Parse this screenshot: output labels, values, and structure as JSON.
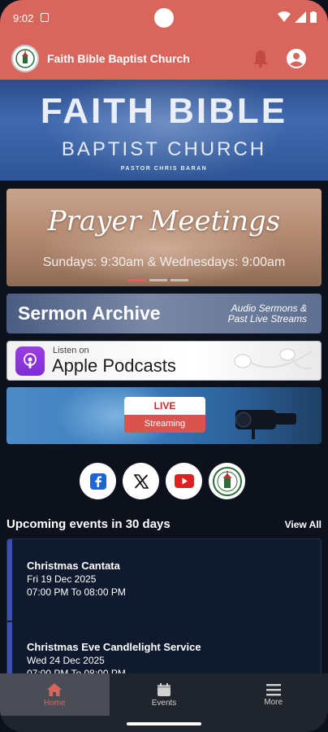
{
  "status_bar": {
    "time": "9:02"
  },
  "app_bar": {
    "title": "Faith Bible Baptist Church"
  },
  "header_banner": {
    "line1": "FAITH BIBLE",
    "line2": "BAPTIST CHURCH",
    "line3": "PASTOR CHRIS BARAN"
  },
  "prayer_card": {
    "title": "Prayer Meetings",
    "subtitle": "Sundays: 9:30am & Wednesdays: 9:00am"
  },
  "sermon_card": {
    "title": "Sermon Archive",
    "subtitle_line1": "Audio Sermons &",
    "subtitle_line2": "Past Live Streams"
  },
  "podcast_card": {
    "listen_on": "Listen on",
    "name": "Apple Podcasts"
  },
  "live_card": {
    "live_label": "LIVE",
    "streaming_label": "Streaming"
  },
  "social": {
    "icons": [
      "facebook-icon",
      "x-icon",
      "youtube-icon",
      "church-logo-icon"
    ]
  },
  "events": {
    "heading": "Upcoming events in 30 days",
    "view_all": "View All",
    "items": [
      {
        "name": "Christmas Cantata",
        "date": "Fri 19 Dec  2025",
        "time": "07:00 PM To 08:00 PM"
      },
      {
        "name": "Christmas Eve Candlelight Service",
        "date": "Wed 24 Dec  2025",
        "time": "07:00 PM To 08:00 PM"
      }
    ]
  },
  "bottom_nav": {
    "items": [
      {
        "label": "Home",
        "icon": "home-icon",
        "active": true
      },
      {
        "label": "Events",
        "icon": "calendar-icon",
        "active": false
      },
      {
        "label": "More",
        "icon": "menu-icon",
        "active": false
      }
    ]
  },
  "colors": {
    "brand": "#d9665c",
    "background": "#0d111c",
    "event_accent": "#3b4fb5"
  }
}
